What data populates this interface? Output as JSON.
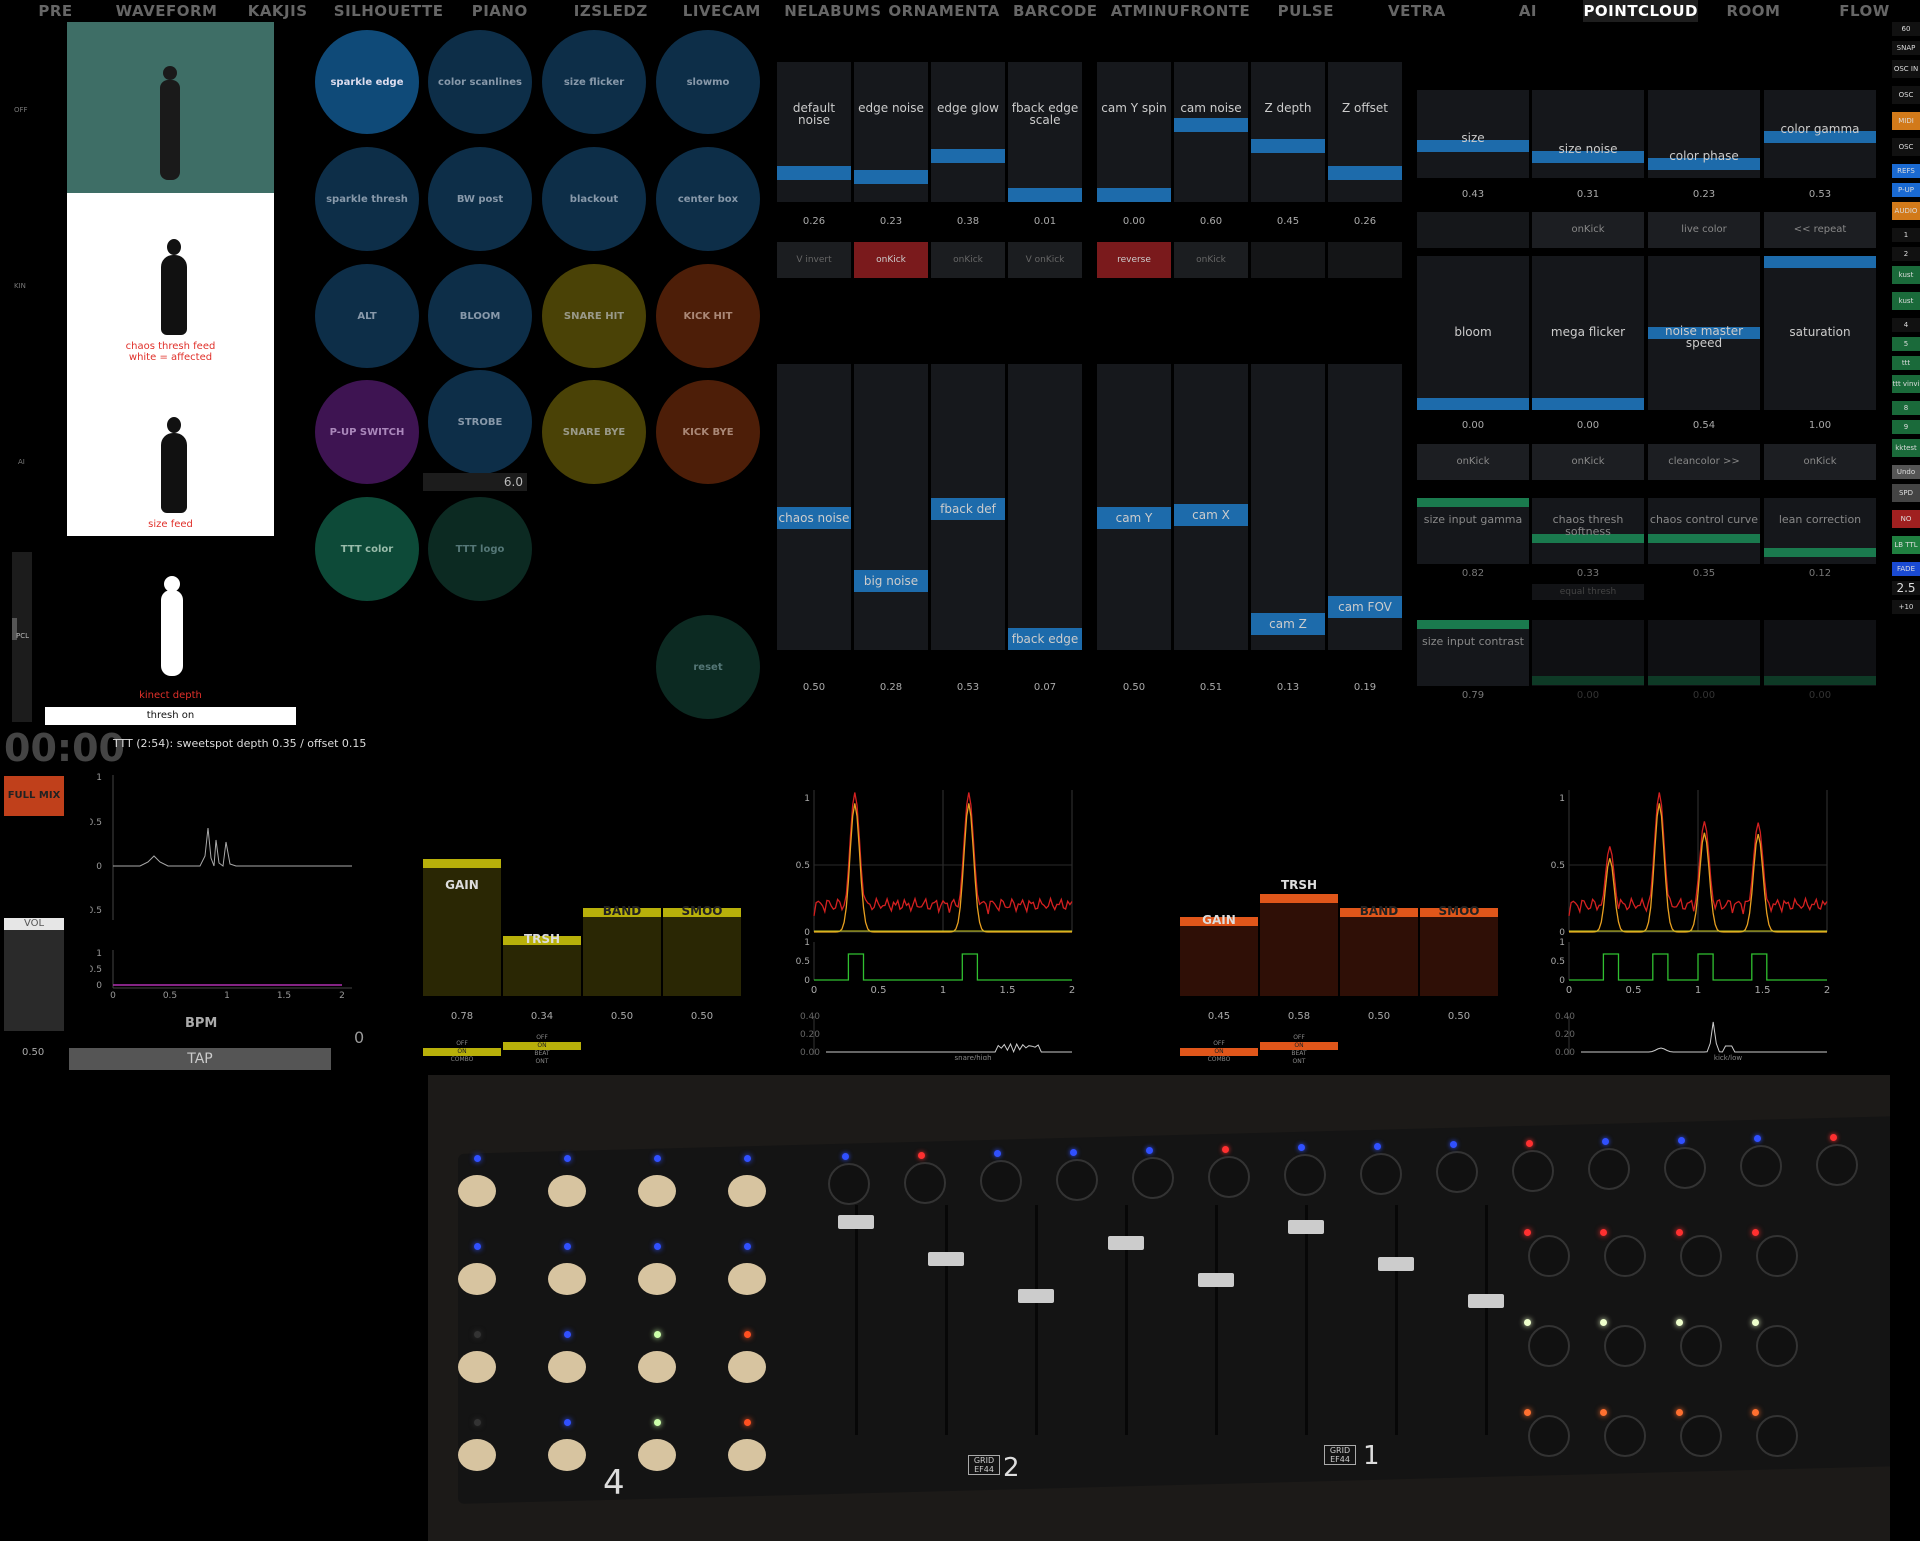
{
  "tabs": [
    "PRE",
    "WAVEFORM",
    "KAKJIS",
    "SILHOUETTE",
    "PIANO",
    "IZSLEDZ",
    "LIVECAM",
    "NELABUMS",
    "ORNAMENTA",
    "BARCODE",
    "ATMINUFRONTE",
    "PULSE",
    "VETRA",
    "AI",
    "POINTCLOUD",
    "ROOM",
    "FLOW"
  ],
  "active_tab": "POINTCLOUD",
  "left_labels": [
    "OFF",
    "KIN",
    "AI",
    "PCL"
  ],
  "preview": {
    "chaos_label_1": "chaos thresh feed",
    "chaos_label_2": "white = affected",
    "size_label": "size feed",
    "kinect_label": "kinect depth",
    "thresh_button": "thresh on"
  },
  "circle_buttons": [
    {
      "label": "sparkle edge",
      "color": "#0f4a78",
      "text": "#dde"
    },
    {
      "label": "color scanlines",
      "color": "#0d2e48",
      "text": "#89a"
    },
    {
      "label": "size flicker",
      "color": "#0d2e48",
      "text": "#89a"
    },
    {
      "label": "slowmo",
      "color": "#0d2e48",
      "text": "#89a"
    },
    {
      "label": "sparkle thresh",
      "color": "#0d2e48",
      "text": "#89a"
    },
    {
      "label": "BW post",
      "color": "#0d2e48",
      "text": "#89a"
    },
    {
      "label": "blackout",
      "color": "#0d2e48",
      "text": "#89a"
    },
    {
      "label": "center box",
      "color": "#0d2e48",
      "text": "#89a"
    },
    {
      "label": "ALT",
      "color": "#0d2e48",
      "text": "#89a"
    },
    {
      "label": "BLOOM",
      "color": "#0d2e48",
      "text": "#89a"
    },
    {
      "label": "SNARE HIT",
      "color": "#4a4206",
      "text": "#998"
    },
    {
      "label": "KICK HIT",
      "color": "#4d1e08",
      "text": "#a87"
    },
    {
      "label": "P-UP SWITCH",
      "color": "#3e1452",
      "text": "#a8b"
    },
    {
      "label": "STROBE",
      "color": "#0d2e48",
      "text": "#89a"
    },
    {
      "label": "SNARE BYE",
      "color": "#4a4206",
      "text": "#998"
    },
    {
      "label": "KICK BYE",
      "color": "#4d1e08",
      "text": "#a87"
    },
    {
      "label": "TTT color",
      "color": "#0d4a38",
      "text": "#9ba"
    },
    {
      "label": "TTT logo",
      "color": "#0c2a22",
      "text": "#577"
    },
    {
      "label": "reset",
      "color": "#0c2a22",
      "text": "#577"
    }
  ],
  "strobe_value": "6.0",
  "mid_sliders_top": [
    {
      "label": "default noise",
      "value": "0.26",
      "level": 0.26
    },
    {
      "label": "edge noise",
      "value": "0.23",
      "level": 0.23
    },
    {
      "label": "edge glow",
      "value": "0.38",
      "level": 0.38
    },
    {
      "label": "fback edge scale",
      "value": "0.01",
      "level": 0.01
    },
    {
      "label": "cam Y spin",
      "value": "0.00",
      "level": 0.0
    },
    {
      "label": "cam noise",
      "value": "0.60",
      "level": 0.6
    },
    {
      "label": "Z depth",
      "value": "0.45",
      "level": 0.45
    },
    {
      "label": "Z offset",
      "value": "0.26",
      "level": 0.26
    }
  ],
  "mid_buttons": [
    "V invert",
    "onKick",
    "onKick",
    "V onKick",
    "reverse",
    "onKick",
    "",
    ""
  ],
  "mid_sliders_bottom": [
    {
      "label": "chaos noise",
      "value": "0.50",
      "level": 0.5
    },
    {
      "label": "big noise",
      "value": "0.28",
      "level": 0.28
    },
    {
      "label": "fback def",
      "value": "0.53",
      "level": 0.53
    },
    {
      "label": "fback edge",
      "value": "0.07",
      "level": 0.07
    },
    {
      "label": "cam Y",
      "value": "0.50",
      "level": 0.5
    },
    {
      "label": "cam X",
      "value": "0.51",
      "level": 0.51
    },
    {
      "label": "cam Z",
      "value": "0.13",
      "level": 0.13
    },
    {
      "label": "cam FOV",
      "value": "0.19",
      "level": 0.19
    }
  ],
  "right_sliders_1": [
    {
      "label": "size",
      "value": "0.43",
      "level": 0.43
    },
    {
      "label": "size noise",
      "value": "0.31",
      "level": 0.31
    },
    {
      "label": "color phase",
      "value": "0.23",
      "level": 0.23
    },
    {
      "label": "color gamma",
      "value": "0.53",
      "level": 0.53
    }
  ],
  "right_buttons_1": [
    "",
    "onKick",
    "live color",
    "<< repeat"
  ],
  "right_sliders_2": [
    {
      "label": "bloom",
      "value": "0.00",
      "level": 0.0
    },
    {
      "label": "mega flicker",
      "value": "0.00",
      "level": 0.0
    },
    {
      "label": "noise master speed",
      "value": "0.54",
      "level": 0.54
    },
    {
      "label": "saturation",
      "value": "1.00",
      "level": 1.0
    }
  ],
  "right_buttons_2": [
    "onKick",
    "onKick",
    "cleancolor >>",
    "onKick"
  ],
  "right_green_1": [
    {
      "label": "size input gamma",
      "value": "0.82"
    },
    {
      "label": "chaos thresh softness",
      "value": "0.33"
    },
    {
      "label": "chaos control curve",
      "value": "0.35"
    },
    {
      "label": "lean correction",
      "value": "0.12"
    }
  ],
  "equal_thresh": "equal thresh",
  "right_green_2": [
    {
      "label": "size input contrast",
      "value": "0.79"
    },
    {
      "label": "",
      "value": "0.00"
    },
    {
      "label": "",
      "value": "0.00"
    },
    {
      "label": "",
      "value": "0.00"
    }
  ],
  "side_strip": [
    "60",
    "SNAP",
    "OSC IN",
    "OSC RAW",
    "MIDI OUT",
    "OSC OUT",
    "REFS",
    "P-UP",
    "AUDIO",
    "1",
    "2",
    "kust early",
    "kust swee",
    "4",
    "5",
    "ttt",
    "ttt vinvi",
    "8",
    "9",
    "kktest",
    "Undo",
    "SPD TTL",
    "NO CORE",
    "LB TTL",
    "FADE",
    "2.5",
    "+10"
  ],
  "timer": "00:00",
  "ttt_info": "TTT (2:54): sweetspot depth 0.35 / offset 0.15",
  "full_mix": "FULL MIX",
  "vol_label": "VOL",
  "vol_value": "0.50",
  "bpm_label": "BPM",
  "bpm_value": "0",
  "tap_label": "TAP",
  "bpm_plot": {
    "yticks": [
      "1",
      "0.5",
      "0",
      "-0.5"
    ],
    "y2ticks": [
      "1",
      "0.5",
      "0"
    ],
    "xticks": [
      "0",
      "0.5",
      "1",
      "1.5",
      "2"
    ]
  },
  "snare": {
    "bars": [
      {
        "label": "GAIN",
        "value": "0.78",
        "level": 0.78
      },
      {
        "label": "TRSH",
        "value": "0.34",
        "level": 0.34
      },
      {
        "label": "BAND",
        "value": "0.50",
        "level": 0.5
      },
      {
        "label": "SMOO",
        "value": "0.50",
        "level": 0.5
      }
    ],
    "toggles_a": [
      "OFF",
      "ON",
      "COMBO"
    ],
    "toggles_b": [
      "OFF",
      "ON",
      "BEAT",
      "ONT"
    ],
    "color": "#b8b00a",
    "dark": "#2a2704",
    "plot_caption": "snare/high"
  },
  "kick": {
    "bars": [
      {
        "label": "GAIN",
        "value": "0.45",
        "level": 0.45
      },
      {
        "label": "TRSH",
        "value": "0.58",
        "level": 0.58
      },
      {
        "label": "BAND",
        "value": "0.50",
        "level": 0.5
      },
      {
        "label": "SMOO",
        "value": "0.50",
        "level": 0.5
      }
    ],
    "toggles_a": [
      "OFF",
      "ON",
      "COMBO"
    ],
    "toggles_b": [
      "OFF",
      "ON",
      "BEAT",
      "ONT"
    ],
    "color": "#e0561a",
    "dark": "#2f0f06",
    "plot_caption": "kick/low"
  },
  "plot_ticks": {
    "y": [
      "1",
      "0.5",
      "0"
    ],
    "y2": [
      "1",
      "0.5",
      "0"
    ],
    "x": [
      "0",
      "0.5",
      "1",
      "1.5",
      "2"
    ],
    "spec_y": [
      "0.40",
      "0.20",
      "0.00"
    ]
  },
  "controller": {
    "labels": [
      "4",
      "2",
      "1"
    ],
    "brand_a": "GRID EF44",
    "brand_b": "GRID EF44"
  }
}
